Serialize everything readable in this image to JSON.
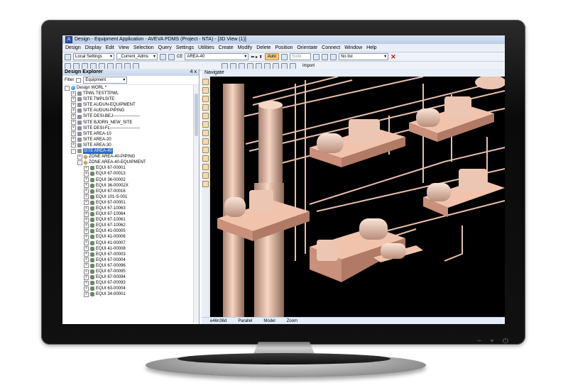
{
  "window": {
    "title": "Design - Equipment Application - AVEVA PDMS (Project - NTA) - [3D View (1)]",
    "app_icon_letter": "A"
  },
  "menu": [
    "Design",
    "Display",
    "Edit",
    "View",
    "Selection",
    "Query",
    "Settings",
    "Utilities",
    "Create",
    "Modify",
    "Delete",
    "Position",
    "Orientate",
    "Connect",
    "Window",
    "Help"
  ],
  "toolbar1": {
    "settings_value": "Local Settings",
    "mdb_value": "_Current_Adms",
    "ce_label": "CE",
    "ce_value": "AREA-40",
    "auto_label": "Auto",
    "solid_label": "Solid",
    "list_value": "No list"
  },
  "toolbar2": {
    "import_label": "Import"
  },
  "explorer": {
    "title": "Design Explorer",
    "pin": "4 x",
    "filter_label": "Filter",
    "filter_value": "Equipment",
    "rows": [
      {
        "level": 0,
        "exp": "-",
        "icon": "world",
        "label": "Design WORL *"
      },
      {
        "level": 1,
        "exp": "+",
        "icon": "site",
        "label": "TPWL TESTTPWL"
      },
      {
        "level": 1,
        "exp": "+",
        "icon": "site",
        "label": "SITE TMPLSITE"
      },
      {
        "level": 1,
        "exp": "+",
        "icon": "site",
        "label": "SITE AUDUN-EQUIPMENT"
      },
      {
        "level": 1,
        "exp": "+",
        "icon": "site",
        "label": "SITE AUDUN-PIPING"
      },
      {
        "level": 1,
        "exp": "+",
        "icon": "site",
        "label": "SITE DESI-BEJ-------------------"
      },
      {
        "level": 1,
        "exp": "+",
        "icon": "site",
        "label": "SITE BJORN_NEW_SITE"
      },
      {
        "level": 1,
        "exp": "+",
        "icon": "site",
        "label": "SITE DESI-FL---------------------"
      },
      {
        "level": 1,
        "exp": "+",
        "icon": "site",
        "label": "SITE AREA-10"
      },
      {
        "level": 1,
        "exp": "+",
        "icon": "site",
        "label": "SITE AREA-20"
      },
      {
        "level": 1,
        "exp": "+",
        "icon": "site",
        "label": "SITE AREA-30"
      },
      {
        "level": 1,
        "exp": "-",
        "icon": "site",
        "label": "SITE AREA-40",
        "selected": true
      },
      {
        "level": 2,
        "exp": "+",
        "icon": "zone",
        "label": "ZONE AREA-40-PIPING"
      },
      {
        "level": 2,
        "exp": "-",
        "icon": "zone",
        "label": "ZONE AREA-40-EQUIPMENT"
      },
      {
        "level": 3,
        "exp": "+",
        "icon": "equi",
        "label": "EQUI 67-00001"
      },
      {
        "level": 3,
        "exp": "+",
        "icon": "equi",
        "label": "EQUI 67-00013"
      },
      {
        "level": 3,
        "exp": "+",
        "icon": "equi",
        "label": "EQUI 36-00002"
      },
      {
        "level": 3,
        "exp": "+",
        "icon": "equi",
        "label": "EQUI 36-00002X"
      },
      {
        "level": 3,
        "exp": "+",
        "icon": "equi",
        "label": "EQUI 67-00016"
      },
      {
        "level": 3,
        "exp": "+",
        "icon": "equi",
        "label": "EQUI 101-S-001"
      },
      {
        "level": 3,
        "exp": "+",
        "icon": "equi",
        "label": "EQUI 67-00001"
      },
      {
        "level": 3,
        "exp": "+",
        "icon": "equi",
        "label": "EQUI 67-10063"
      },
      {
        "level": 3,
        "exp": "+",
        "icon": "equi",
        "label": "EQUI 67-10064"
      },
      {
        "level": 3,
        "exp": "+",
        "icon": "equi",
        "label": "EQUI 67-10061"
      },
      {
        "level": 3,
        "exp": "+",
        "icon": "equi",
        "label": "EQUI 67-10062"
      },
      {
        "level": 3,
        "exp": "+",
        "icon": "equi",
        "label": "EQUI 41-00005"
      },
      {
        "level": 3,
        "exp": "+",
        "icon": "equi",
        "label": "EQUI 41-00006"
      },
      {
        "level": 3,
        "exp": "+",
        "icon": "equi",
        "label": "EQUI 41-00007"
      },
      {
        "level": 3,
        "exp": "+",
        "icon": "equi",
        "label": "EQUI 41-00008"
      },
      {
        "level": 3,
        "exp": "+",
        "icon": "equi",
        "label": "EQUI 67-00003"
      },
      {
        "level": 3,
        "exp": "+",
        "icon": "equi",
        "label": "EQUI 67-00004"
      },
      {
        "level": 3,
        "exp": "+",
        "icon": "equi",
        "label": "EQUI 67-00096"
      },
      {
        "level": 3,
        "exp": "+",
        "icon": "equi",
        "label": "EQUI 67-00095"
      },
      {
        "level": 3,
        "exp": "+",
        "icon": "equi",
        "label": "EQUI 67-00094"
      },
      {
        "level": 3,
        "exp": "+",
        "icon": "equi",
        "label": "EQUI 67-00093"
      },
      {
        "level": 3,
        "exp": "+",
        "icon": "equi",
        "label": "EQUI 63-00004"
      },
      {
        "level": 3,
        "exp": "+",
        "icon": "equi",
        "label": "EQUI 34-00001"
      }
    ]
  },
  "view": {
    "tab_label": "Navigate",
    "status": [
      "e46n36d",
      "Parallel",
      "Model",
      "Zoom"
    ]
  },
  "colors": {
    "model": "#f2c9b4",
    "background": "#000000",
    "selection": "#3169c6"
  }
}
